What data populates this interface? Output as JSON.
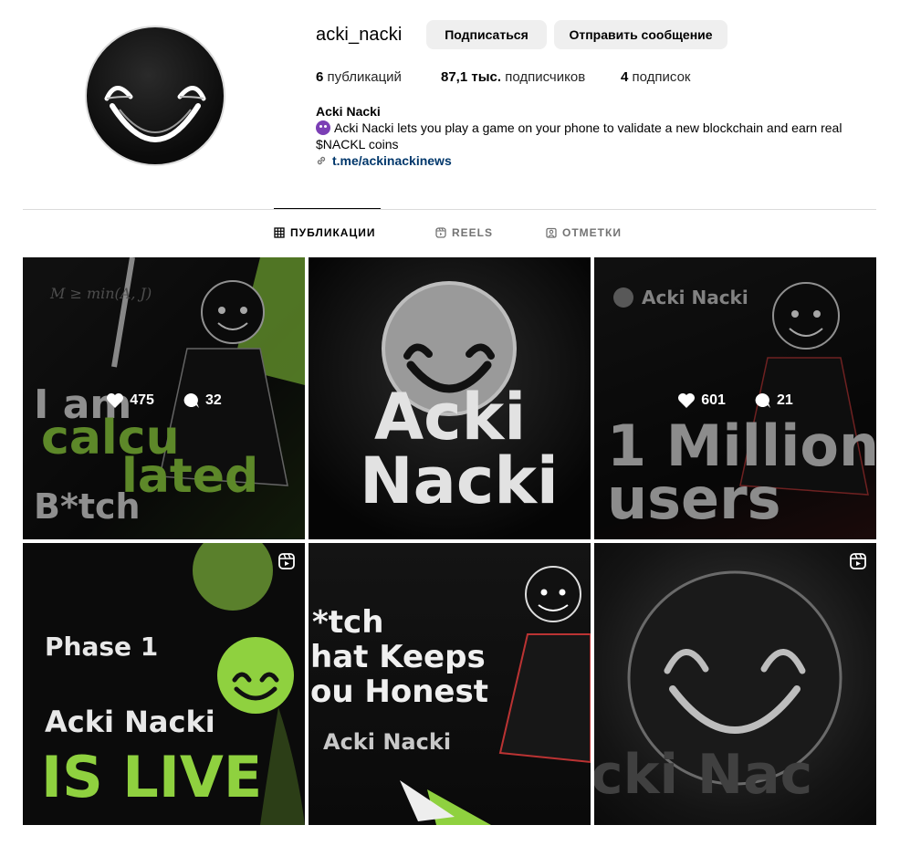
{
  "profile": {
    "username": "acki_nacki",
    "follow_label": "Подписаться",
    "message_label": "Отправить сообщение",
    "stats": {
      "posts_count": "6",
      "posts_label": "публикаций",
      "followers_count": "87,1 тыс.",
      "followers_label": "подписчиков",
      "following_count": "4",
      "following_label": "подписок"
    },
    "bio_name": "Acki Nacki",
    "bio_text": "Acki Nacki lets you play a game on your phone to validate a new blockchain and earn real $NACKL coins",
    "link": "t.me/ackinackinews"
  },
  "tabs": [
    {
      "label": "ПУБЛИКАЦИИ",
      "icon": "grid-icon",
      "active": true
    },
    {
      "label": "REELS",
      "icon": "reels-icon",
      "active": false
    },
    {
      "label": "ОТМЕТКИ",
      "icon": "tagged-icon",
      "active": false
    }
  ],
  "posts": [
    {
      "lines": [
        "I am",
        "calcu",
        "lated",
        "B*tch"
      ],
      "likes": "475",
      "comments": "32",
      "formula": "M ≥ min(A, J)"
    },
    {
      "lines": [
        "Acki",
        "Nacki"
      ]
    },
    {
      "brand": "Acki Nacki",
      "lines": [
        "1 Million",
        "users"
      ],
      "likes": "601",
      "comments": "21"
    },
    {
      "lines": [
        "Phase 1",
        "Acki Nacki",
        "IS LIVE"
      ]
    },
    {
      "lines": [
        "*tch",
        "hat Keeps",
        "ou Honest",
        "Acki Nacki"
      ]
    },
    {
      "lines": [
        "cki Nac"
      ]
    }
  ],
  "colors": {
    "accent_green": "#8fd13f",
    "link": "#00376b",
    "selection": "#2f5fd6"
  }
}
